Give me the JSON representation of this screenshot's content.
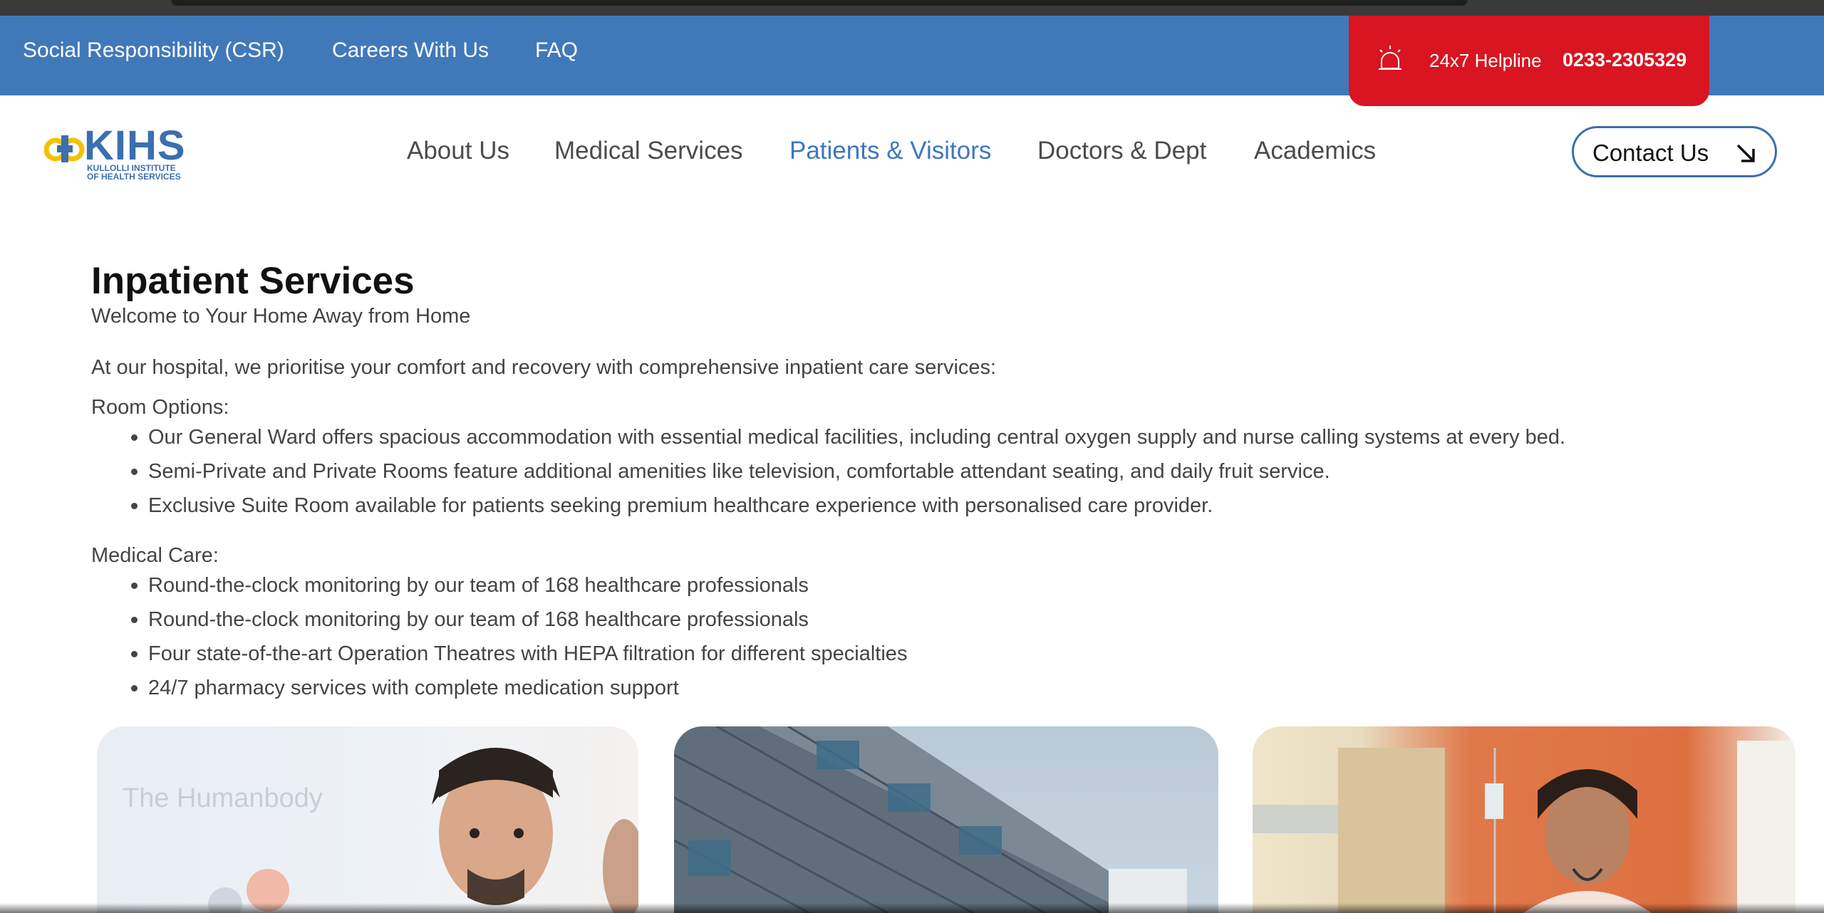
{
  "topbar": {
    "links": [
      "Social Responsibility (CSR)",
      "Careers With Us",
      "FAQ"
    ],
    "helpline_label": "24x7 Helpline",
    "helpline_number": "0233-2305329"
  },
  "logo": {
    "text": "KIHS",
    "line1": "KULLOLLI INSTITUTE",
    "line2": "OF HEALTH SERVICES"
  },
  "nav": {
    "items": [
      "About Us",
      "Medical Services",
      "Patients & Visitors",
      "Doctors & Dept",
      "Academics"
    ],
    "active": "Patients & Visitors",
    "contact_label": "Contact Us"
  },
  "page": {
    "title": "Inpatient Services",
    "subtitle": "Welcome to Your Home Away from Home",
    "intro": "At our hospital, we prioritise your comfort and recovery with comprehensive inpatient care services:",
    "room_heading": "Room Options:",
    "room_items": [
      "Our General Ward offers spacious accommodation with essential medical facilities, including central oxygen supply and nurse calling systems at every bed.",
      "Semi-Private and Private Rooms feature additional amenities like television, comfortable attendant seating, and daily fruit service.",
      "Exclusive Suite Room available for patients seeking premium healthcare experience with personalised care provider."
    ],
    "care_heading": "Medical Care:",
    "care_items": [
      "Round-the-clock monitoring by our team of 168 healthcare professionals",
      "Round-the-clock monitoring by our team of 168 healthcare professionals",
      "Four state-of-the-art Operation Theatres with HEPA filtration for different specialties",
      "24/7 pharmacy services with complete medication support"
    ]
  },
  "cards": {
    "card1_text": "The Humanbody"
  },
  "colors": {
    "topbar": "#4079ba",
    "helpline": "#d81520",
    "active_nav": "#3d78bd",
    "logo_blue": "#3b6fb0",
    "logo_yellow": "#f2c200"
  }
}
